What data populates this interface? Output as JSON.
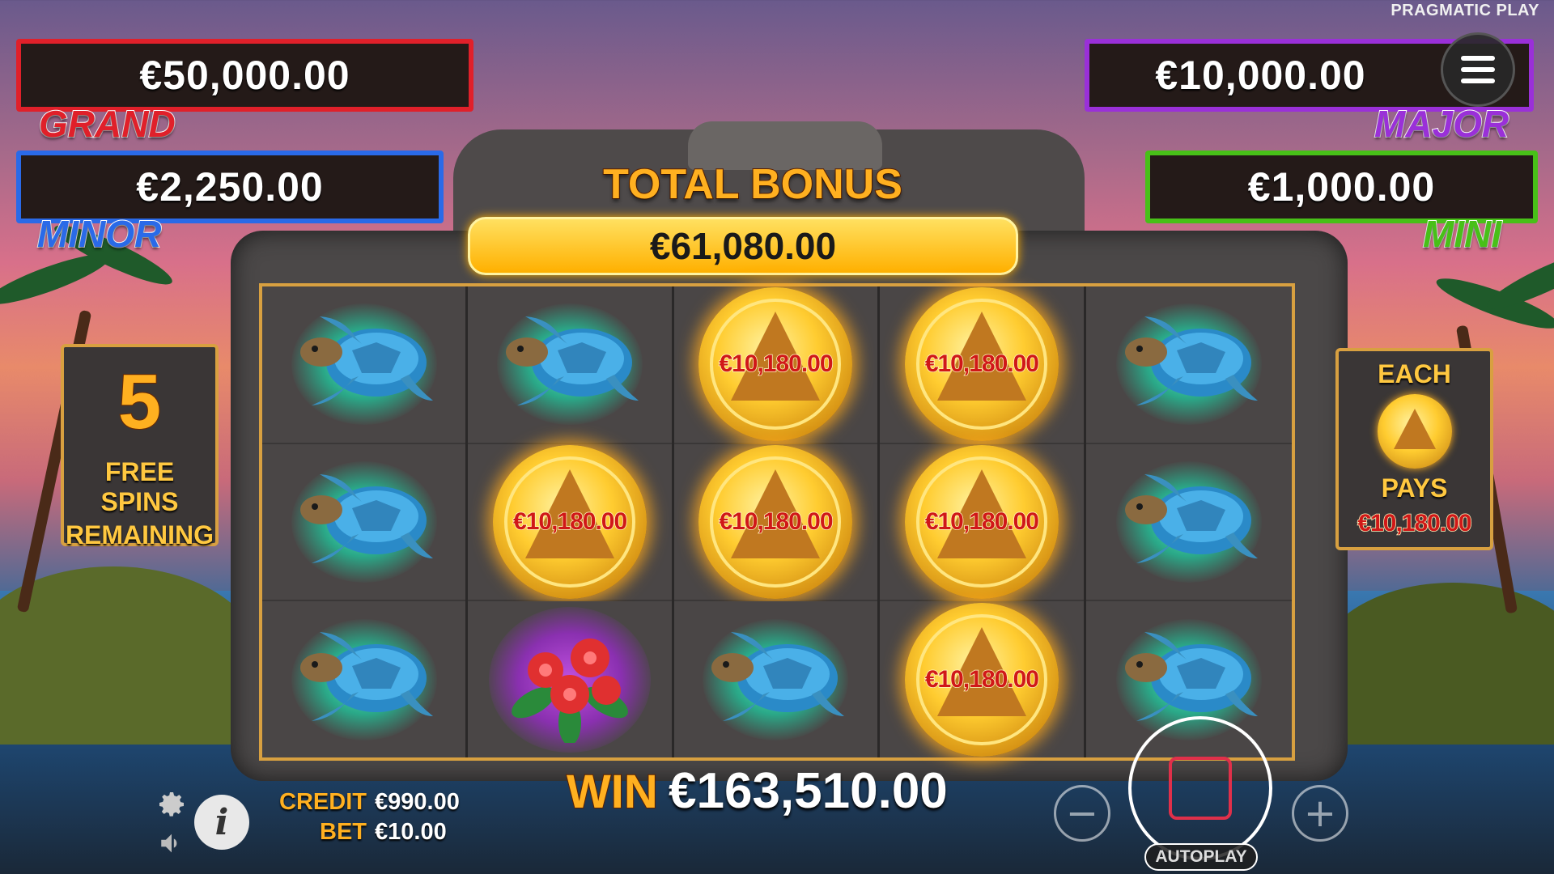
{
  "brand": "PRAGMATIC PLAY",
  "jackpots": {
    "grand": {
      "amount": "€50,000.00",
      "label": "GRAND",
      "color": "#e0202a"
    },
    "minor": {
      "amount": "€2,250.00",
      "label": "MINOR",
      "color": "#2a6ae8"
    },
    "major": {
      "amount": "€10,000.00",
      "label": "MAJOR",
      "color": "#9a30d8"
    },
    "mini": {
      "amount": "€1,000.00",
      "label": "MINI",
      "color": "#48c018"
    }
  },
  "bonus": {
    "title": "TOTAL BONUS",
    "value": "€61,080.00"
  },
  "free_spins": {
    "count": "5",
    "text_line1": "FREE SPINS",
    "text_line2": "REMAINING"
  },
  "each_pays": {
    "top": "EACH",
    "middle": "PAYS",
    "value": "€10,180.00"
  },
  "grid": [
    [
      "turtle",
      "turtle",
      "turtle"
    ],
    [
      "turtle",
      "coin",
      "flower"
    ],
    [
      "coin",
      "coin",
      "turtle"
    ],
    [
      "coin",
      "coin",
      "coin"
    ],
    [
      "turtle",
      "turtle",
      "turtle"
    ]
  ],
  "coin_value": "€10,180.00",
  "win": {
    "label": "WIN",
    "value": "€163,510.00"
  },
  "credit": {
    "label": "CREDIT",
    "value": "€990.00"
  },
  "bet": {
    "label": "BET",
    "value": "€10.00"
  },
  "autoplay_label": "AUTOPLAY",
  "icons": {
    "settings": "gear-icon",
    "sound": "speaker-icon",
    "info": "info-icon",
    "menu": "hamburger-menu-icon",
    "minus": "minus-icon",
    "plus": "plus-icon",
    "stop": "stop-icon"
  },
  "accent": "#ffb020"
}
